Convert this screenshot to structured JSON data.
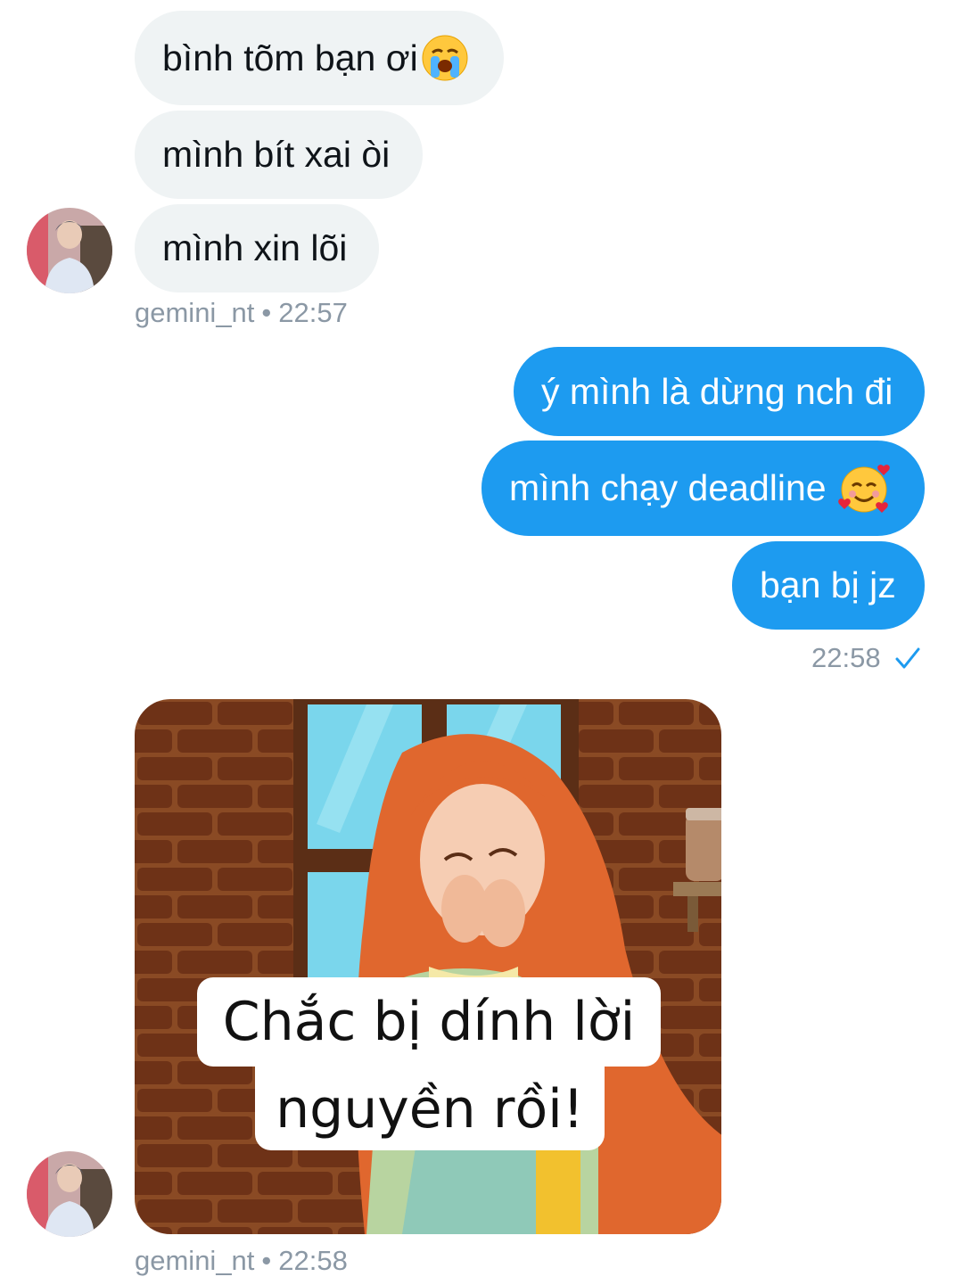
{
  "conversation": {
    "group1": {
      "messages": [
        "bình tõm bạn ơi",
        "mình bít xai òi",
        "mình xin lõi"
      ],
      "first_emoji": "crying-face",
      "sender": "gemini_nt",
      "separator": "•",
      "time": "22:57"
    },
    "group2": {
      "messages": [
        "ý mình là dừng nch đi",
        "mình chạy deadline",
        "bạn bị jz"
      ],
      "second_emoji": "smiling-face-with-hearts",
      "time": "22:58",
      "status_icon": "sent-check-icon"
    },
    "group3": {
      "image_caption_line1": "Chắc bị dính lời",
      "image_caption_line2": "nguyền rồi!",
      "sender": "gemini_nt",
      "separator": "•",
      "time": "22:58"
    }
  },
  "colors": {
    "incoming_bubble": "#eff3f4",
    "outgoing_bubble": "#1d9bf0",
    "meta_text": "#8b98a5",
    "check": "#1d9bf0"
  }
}
